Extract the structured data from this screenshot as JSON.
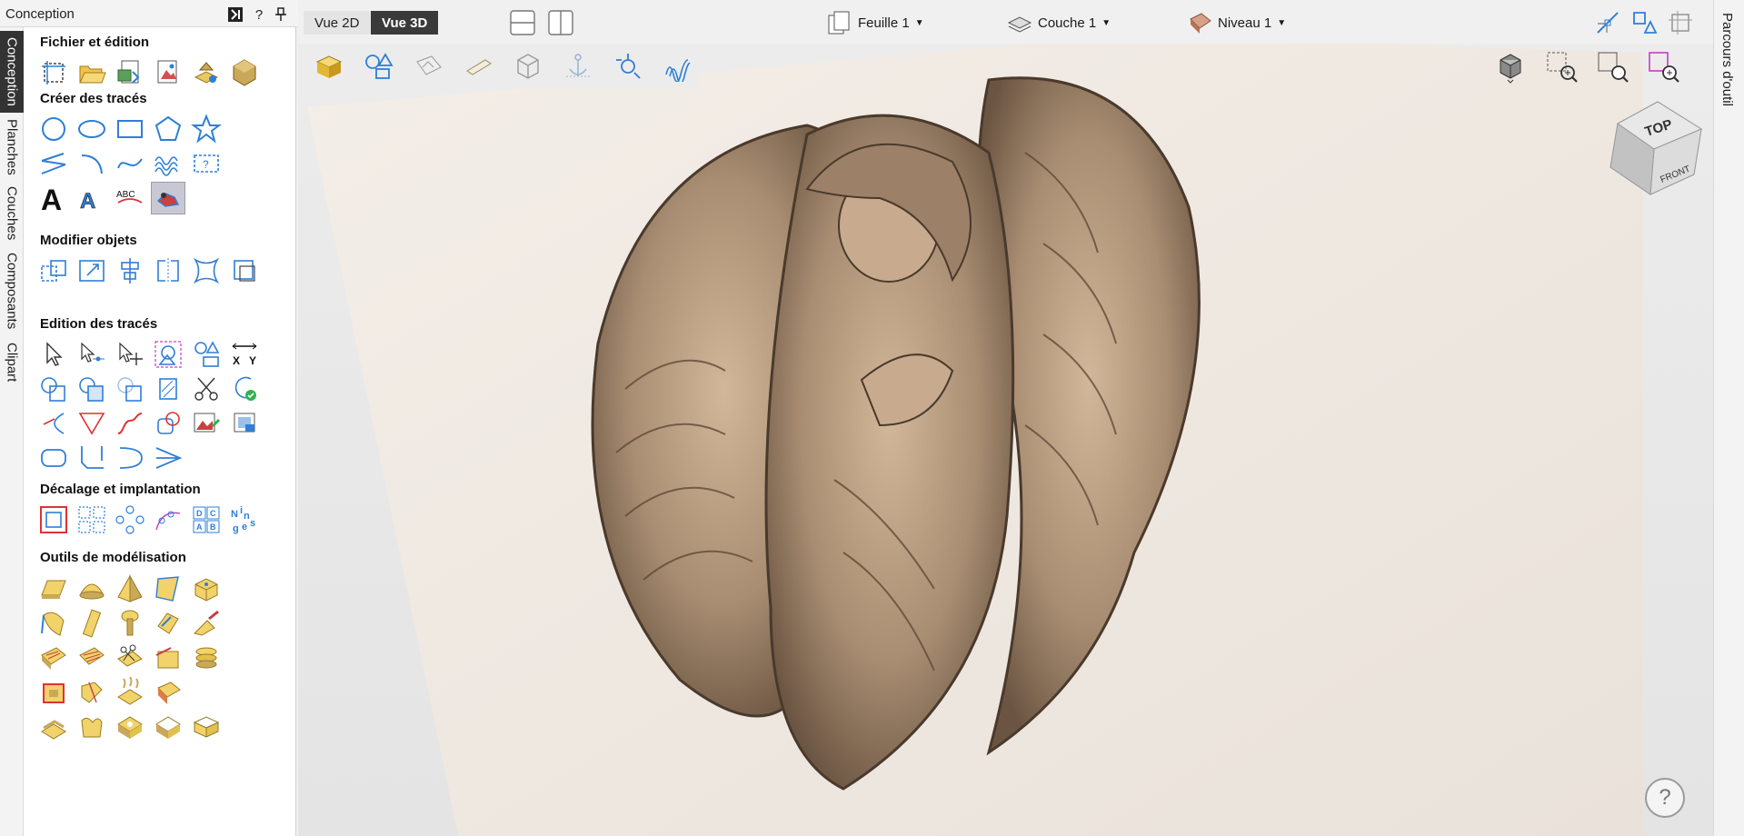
{
  "panel": {
    "title": "Conception",
    "vertical_tabs": [
      "Conception",
      "Planches",
      "Couches",
      "Composants",
      "Clipart"
    ],
    "header_buttons": [
      "pin-panel",
      "help",
      "pin"
    ],
    "help_label": "?",
    "sections": {
      "file": "Fichier et édition",
      "create": "Créer des tracés",
      "modify": "Modifier objets",
      "edit": "Edition des tracés",
      "offset": "Décalage et implantation",
      "model": "Outils de modélisation"
    }
  },
  "topbar": {
    "vue2d": "Vue 2D",
    "vue3d": "Vue 3D",
    "sheet": "Feuille 1",
    "layer": "Couche 1",
    "level": "Niveau 1"
  },
  "viewport": {
    "navcube_top": "TOP",
    "navcube_front": "FRONT",
    "help": "?"
  },
  "right_tab": "Parcours d'outil",
  "colors": {
    "accent_blue": "#2f7fd6",
    "panel_bg": "#ffffff",
    "active_tab": "#333333",
    "relief": "#a88d72"
  }
}
